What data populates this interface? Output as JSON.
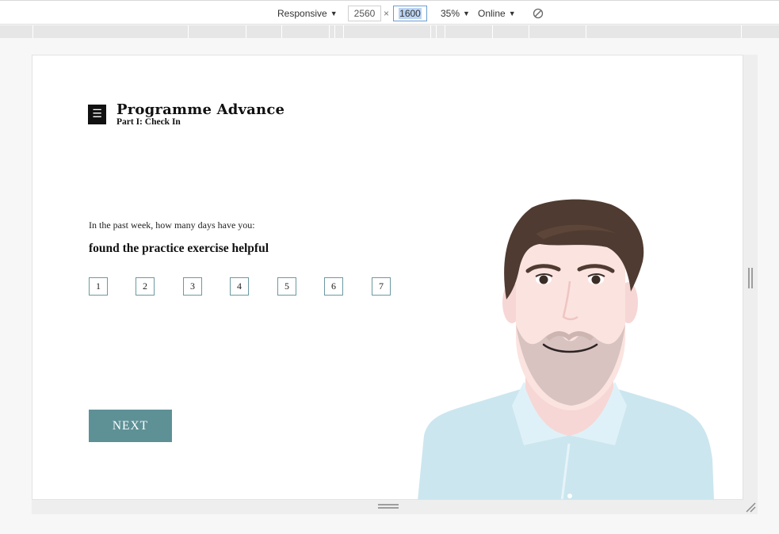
{
  "devtools": {
    "device": "Responsive",
    "width": "2560",
    "times": "×",
    "height": "1600",
    "zoom": "35%",
    "throttle": "Online",
    "icons": {
      "caret": "▼",
      "rotate": "rotate-icon"
    }
  },
  "app": {
    "menu_icon": "☰",
    "title": "Programme Advance",
    "subtitle": "Part I: Check In"
  },
  "question": {
    "prompt": "In the past week, how many days have you:",
    "text": "found the practice exercise helpful",
    "options": [
      "1",
      "2",
      "3",
      "4",
      "5",
      "6",
      "7"
    ]
  },
  "actions": {
    "next_label": "NEXT"
  },
  "colors": {
    "accent": "#5e9196",
    "option_border": "#6a9aa0",
    "hair": "#4f3b31",
    "skin": "#fbe3e0",
    "beard": "#d8c3c0",
    "shirt": "#cbe6ef"
  }
}
